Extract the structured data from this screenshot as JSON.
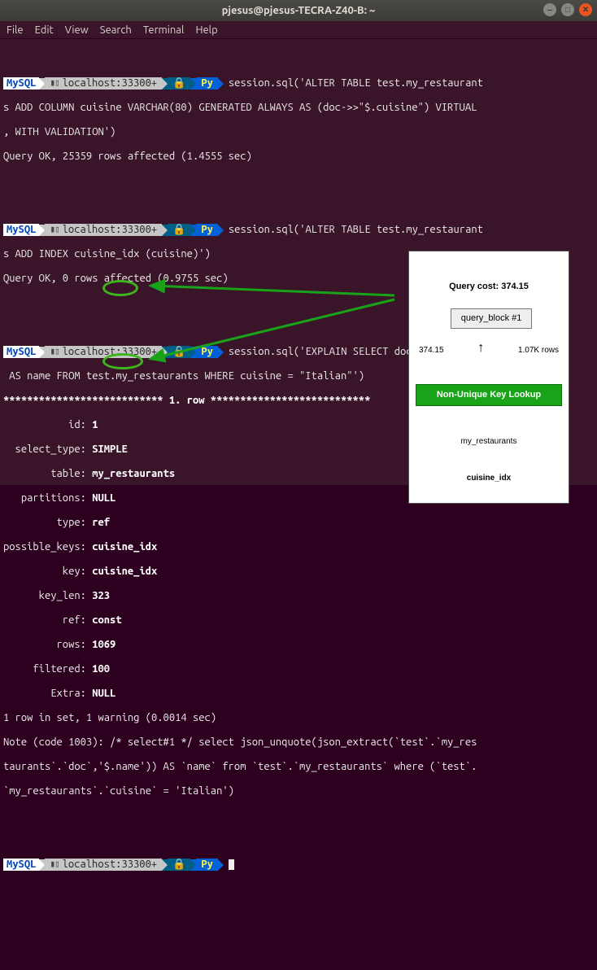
{
  "window": {
    "title": "pjesus@pjesus-TECRA-Z40-B: ~"
  },
  "menu": {
    "file": "File",
    "edit": "Edit",
    "view": "View",
    "search": "Search",
    "terminal": "Terminal",
    "help": "Help"
  },
  "prompt": {
    "mysql": "MySQL",
    "host": "localhost:33300+",
    "lang": "Py"
  },
  "cmd1": "session.sql('ALTER TABLE test.my_restaurant",
  "cmd1b": "s ADD COLUMN cuisine VARCHAR(80) GENERATED ALWAYS AS (doc->>\"$.cuisine\") VIRTUAL",
  "cmd1c": ", WITH VALIDATION')",
  "res1": "Query OK, 25359 rows affected (1.4555 sec)",
  "cmd2": "session.sql('ALTER TABLE test.my_restaurant",
  "cmd2b": "s ADD INDEX cuisine_idx (cuisine)')",
  "res2": "Query OK, 0 rows affected (0.9755 sec)",
  "cmd3": "session.sql('EXPLAIN SELECT doc->>\"$.name\"",
  "cmd3b": " AS name FROM test.my_restaurants WHERE cuisine = \"Italian\"')",
  "rowhdr": "*************************** 1. row ***************************",
  "explain": {
    "labels": {
      "id": "           id:",
      "select_type": "  select_type:",
      "table": "        table:",
      "partitions": "   partitions:",
      "type": "         type:",
      "possible_keys": "possible_keys:",
      "key": "          key:",
      "key_len": "      key_len:",
      "ref": "          ref:",
      "rows": "         rows:",
      "filtered": "     filtered:",
      "extra": "        Extra:"
    },
    "id": "1",
    "select_type": "SIMPLE",
    "table": "my_restaurants",
    "partitions": "NULL",
    "type": "ref",
    "possible_keys": "cuisine_idx",
    "key": "cuisine_idx",
    "key_len": "323",
    "ref": "const",
    "rows": "1069",
    "filtered": "100",
    "extra": "NULL"
  },
  "res3a": "1 row in set, 1 warning (0.0014 sec)",
  "res3b": "Note (code 1003): /* select#1 */ select json_unquote(json_extract(`test`.`my_res",
  "res3c": "taurants`.`doc`,'$.name')) AS `name` from `test`.`my_restaurants` where (`test`.",
  "res3d": "`my_restaurants`.`cuisine` = 'Italian')",
  "diagram": {
    "query_cost": "Query cost: 374.15",
    "block": "query_block #1",
    "cost": "374.15",
    "rows": "1.07K rows",
    "lookup": "Non-Unique Key Lookup",
    "table": "my_restaurants",
    "index": "cuisine_idx"
  }
}
